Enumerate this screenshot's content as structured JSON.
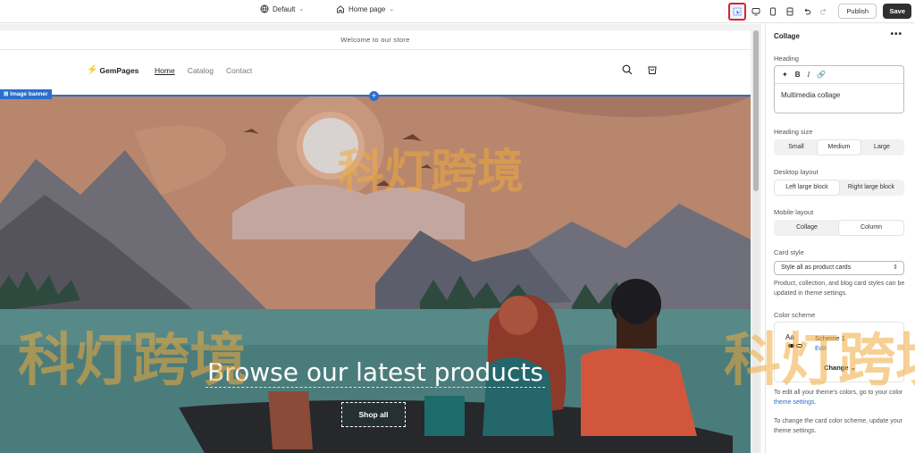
{
  "toolbar": {
    "theme_label": "Default",
    "page_label": "Home page",
    "publish_label": "Publish",
    "save_label": "Save"
  },
  "store": {
    "announcement": "Welcome to our store",
    "logo": "GemPages",
    "nav": [
      "Home",
      "Catalog",
      "Contact"
    ],
    "section_badge": "Image banner",
    "hero_heading": "Browse our latest products",
    "hero_button": "Shop all"
  },
  "watermark": "科灯跨境",
  "panel": {
    "title": "Collage",
    "more": "•••",
    "heading_label": "Heading",
    "heading_value": "Multimedia collage",
    "heading_size_label": "Heading size",
    "heading_sizes": [
      "Small",
      "Medium",
      "Large"
    ],
    "heading_size_selected": "Medium",
    "desktop_layout_label": "Desktop layout",
    "desktop_layouts": [
      "Left large block",
      "Right large block"
    ],
    "mobile_layout_label": "Mobile layout",
    "mobile_layouts": [
      "Collage",
      "Column"
    ],
    "mobile_layout_selected": "Column",
    "card_style_label": "Card style",
    "card_style_value": "Style all as product cards",
    "card_help": "Product, collection, and blog card styles can be updated in theme settings.",
    "color_scheme_label": "Color scheme",
    "scheme_swatch": "Aa",
    "scheme_name": "Scheme 1",
    "scheme_edit": "Edit",
    "scheme_change": "Change",
    "colors_help_pre": "To edit all your theme's colors, go to your color ",
    "colors_help_link": "theme settings",
    "colors_help_post": ".",
    "card_scheme_help": "To change the card color scheme, update your theme settings."
  },
  "colors": {
    "accent": "#2c6ecb",
    "highlight": "#d7262b",
    "save_bg": "#303030"
  }
}
